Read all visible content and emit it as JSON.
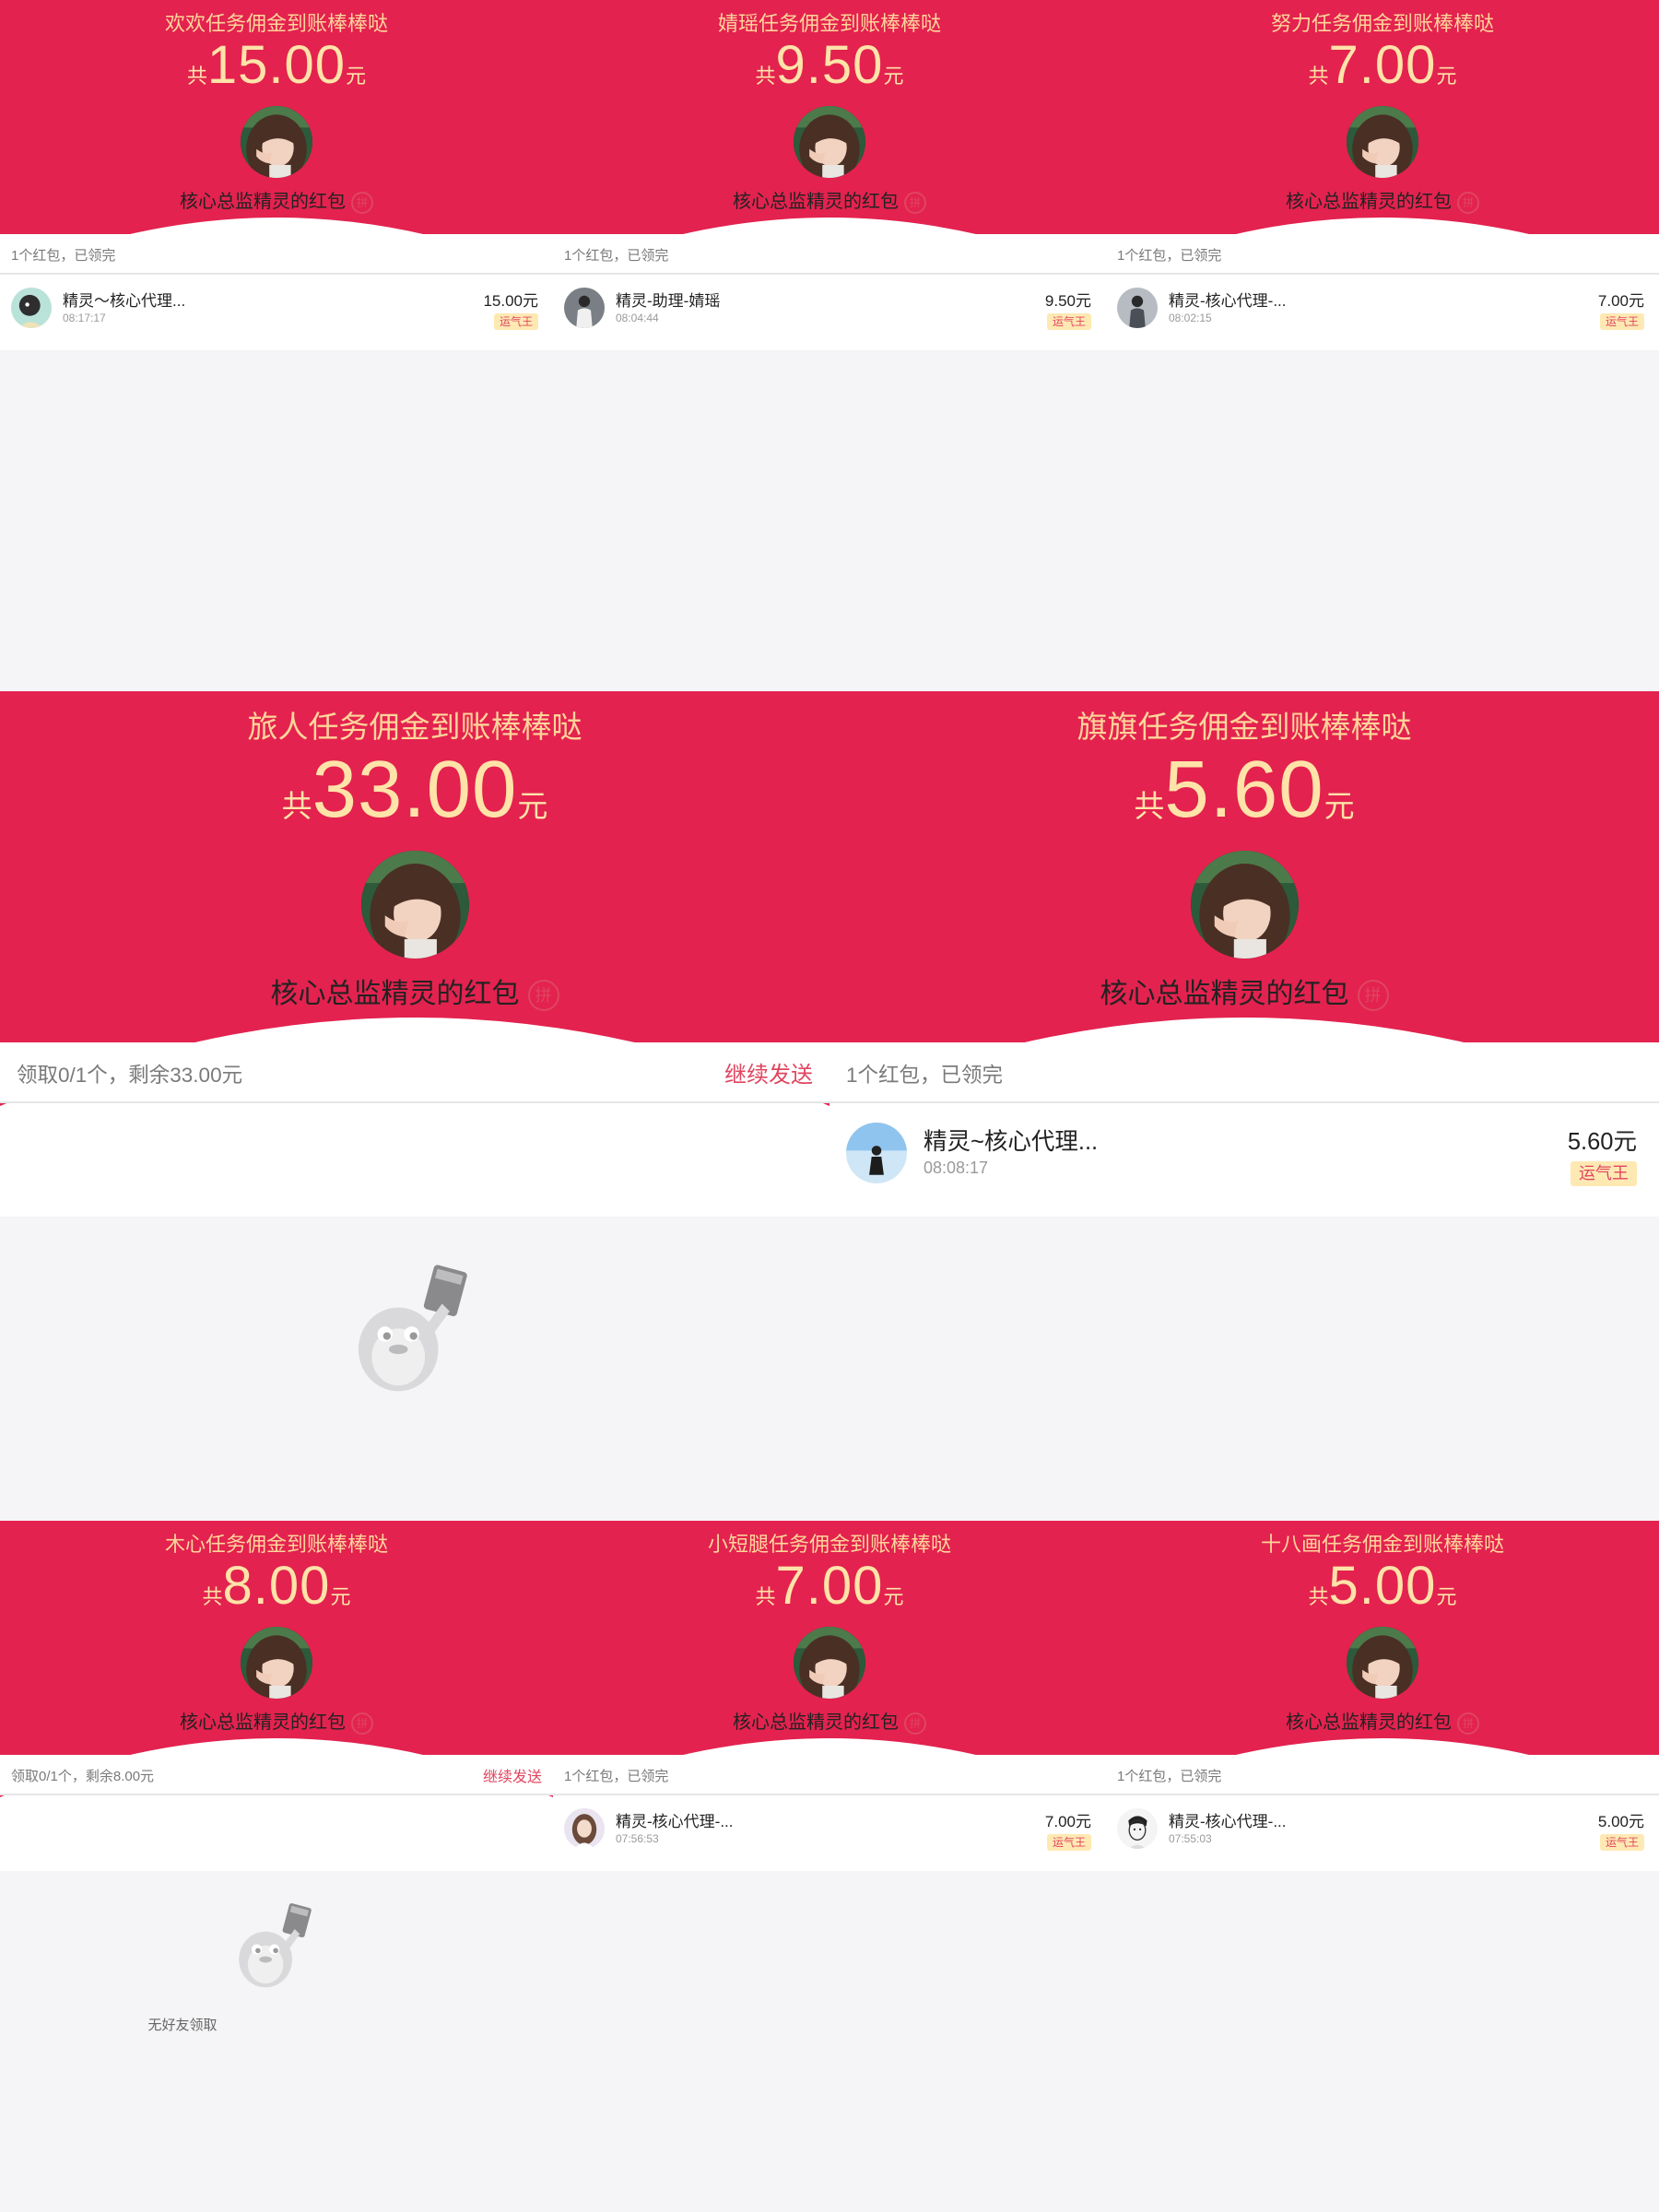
{
  "colors": {
    "header_red": "#e3224f",
    "gold_text": "#ffe3a8",
    "accent": "#e0455f",
    "badge_bg": "#ffe9b3"
  },
  "common": {
    "sender": "核心总监精灵的红包",
    "pin_badge": "拼",
    "currency_prefix": "共",
    "currency_suffix": "元",
    "lucky_badge": "运气王",
    "resend": "继续发送",
    "no_friends": "无好友领取"
  },
  "panels": [
    {
      "title": "欢欢任务佣金到账棒棒哒",
      "amount": "15.00",
      "status": "1个红包，已领完",
      "record": {
        "name": "精灵～核心代理...",
        "time": "08:17:17",
        "amount": "15.00元",
        "avatar_icon": "cartoon-avatar-icon"
      }
    },
    {
      "title": "婧瑶任务佣金到账棒棒哒",
      "amount": "9.50",
      "status": "1个红包，已领完",
      "record": {
        "name": "精灵-助理-婧瑶",
        "time": "08:04:44",
        "amount": "9.50元",
        "avatar_icon": "person-avatar-icon"
      }
    },
    {
      "title": "努力任务佣金到账棒棒哒",
      "amount": "7.00",
      "status": "1个红包，已领完",
      "record": {
        "name": "精灵-核心代理-...",
        "time": "08:02:15",
        "amount": "7.00元",
        "avatar_icon": "person-avatar-icon"
      }
    },
    {
      "title": "旅人任务佣金到账棒棒哒",
      "amount": "33.00",
      "status": "领取0/1个，剩余33.00元",
      "empty": true
    },
    {
      "title": "旗旗任务佣金到账棒棒哒",
      "amount": "5.60",
      "status": "1个红包，已领完",
      "record": {
        "name": "精灵~核心代理...",
        "time": "08:08:17",
        "amount": "5.60元",
        "avatar_icon": "person-avatar-icon"
      }
    },
    {
      "title": "木心任务佣金到账棒棒哒",
      "amount": "8.00",
      "status": "领取0/1个，剩余8.00元",
      "empty": true
    },
    {
      "title": "小短腿任务佣金到账棒棒哒",
      "amount": "7.00",
      "status": "1个红包，已领完",
      "record": {
        "name": "精灵-核心代理-...",
        "time": "07:56:53",
        "amount": "7.00元",
        "avatar_icon": "girl-avatar-icon"
      }
    },
    {
      "title": "十八画任务佣金到账棒棒哒",
      "amount": "5.00",
      "status": "1个红包，已领完",
      "record": {
        "name": "精灵-核心代理-...",
        "time": "07:55:03",
        "amount": "5.00元",
        "avatar_icon": "sketch-avatar-icon"
      }
    }
  ]
}
